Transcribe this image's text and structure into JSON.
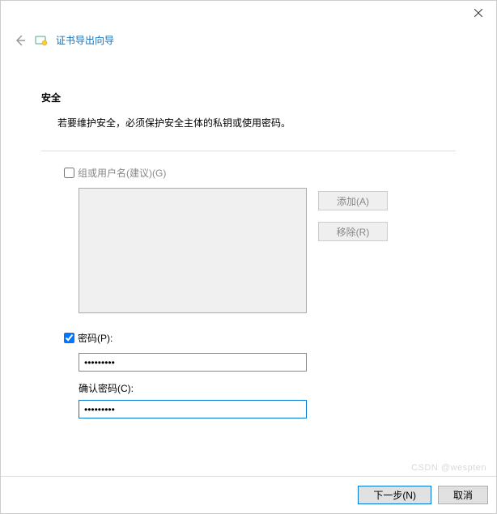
{
  "window": {
    "title": "证书导出向导"
  },
  "section": {
    "heading": "安全",
    "description": "若要维护安全，必须保护安全主体的私钥或使用密码。"
  },
  "groups_checkbox": {
    "label": "组或用户名(建议)(G)",
    "checked": false
  },
  "buttons": {
    "add": "添加(A)",
    "remove": "移除(R)",
    "next": "下一步(N)",
    "cancel": "取消"
  },
  "password_checkbox": {
    "label": "密码(P):",
    "checked": true
  },
  "password_field": {
    "value": "•••••••••"
  },
  "confirm_label": "确认密码(C):",
  "confirm_field": {
    "value": "•••••••••"
  },
  "watermark": "CSDN @wespten"
}
